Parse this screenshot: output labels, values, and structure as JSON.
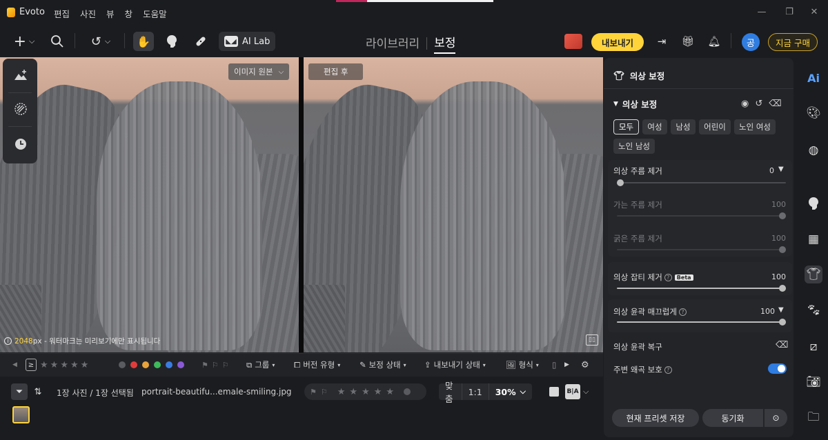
{
  "app": {
    "name": "Evoto",
    "menu": [
      "편집",
      "사진",
      "뷰",
      "창",
      "도움말"
    ]
  },
  "toolbar": {
    "ai_lab_label": "AI Lab",
    "tabs": [
      {
        "label": "라이브러리",
        "active": false
      },
      {
        "label": "보정",
        "active": true
      }
    ],
    "export_label": "내보내기",
    "avatar_initial": "공",
    "buy_label": "지금 구매"
  },
  "canvas": {
    "original_badge": "이미지 원본",
    "after_badge": "편집 후",
    "watermark_px": "2048",
    "watermark_text": "px - 워터마크는 미리보기에만 표시됩니다"
  },
  "filterbar": {
    "rating_colors": [
      "#5a5b60",
      "#e03c3c",
      "#e8a33a",
      "#3dba5a",
      "#3a7de0",
      "#8a5ad6"
    ],
    "items": [
      "그룹",
      "버전 유형",
      "보정 상태",
      "내보내기 상태",
      "형식"
    ]
  },
  "statusbar": {
    "selection_info": "1장 사진 / 1장 선택됨",
    "filename": "portrait-beautifu...emale-smiling.jpg",
    "zoom_fit": "맞춤",
    "zoom_one": "1:1",
    "zoom_pct": "30%"
  },
  "panel": {
    "header": "의상 보정",
    "section": "의상 보정",
    "chips": [
      {
        "label": "모두",
        "selected": true
      },
      {
        "label": "여성",
        "selected": false
      },
      {
        "label": "남성",
        "selected": false
      },
      {
        "label": "어린이",
        "selected": false
      },
      {
        "label": "노인 여성",
        "selected": false
      },
      {
        "label": "노인 남성",
        "selected": false
      }
    ],
    "wrinkle": {
      "label": "의상 주름 제거",
      "value": "0",
      "fine_label": "가는 주름 제거",
      "fine_value": "100",
      "thick_label": "굵은 주름 제거",
      "thick_value": "100",
      "level": 0
    },
    "lint": {
      "label": "의상 잡티 제거",
      "beta": "Beta",
      "value": "100",
      "level": 1.0
    },
    "smooth": {
      "label": "의상 윤곽 매끄럽게",
      "value": "100",
      "level": 1.0
    },
    "restore_label": "의상 윤곽 복구",
    "protect_label": "주변 왜곡 보호",
    "protect_on": true,
    "save_preset_label": "현재 프리셋 저장",
    "sync_label": "동기화"
  }
}
